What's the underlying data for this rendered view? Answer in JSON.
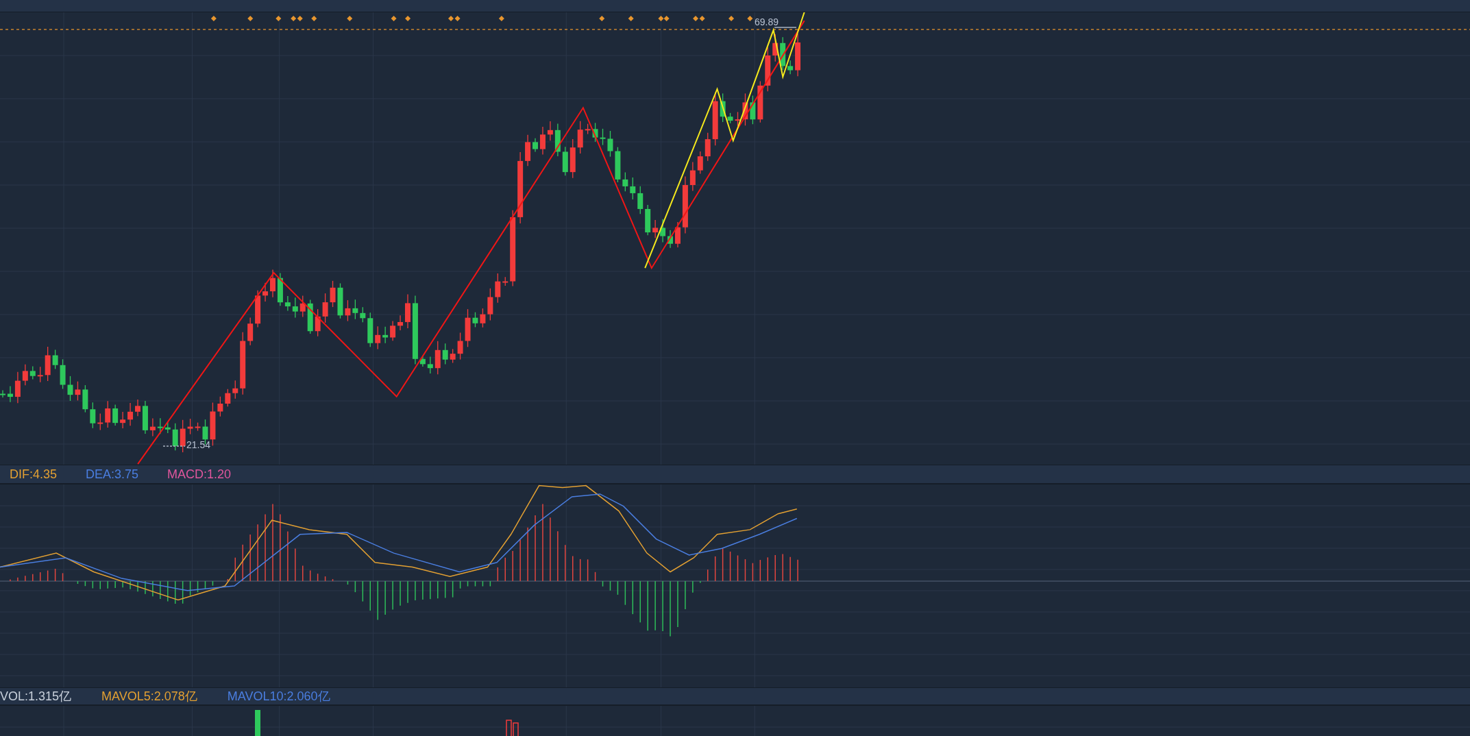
{
  "price_pane": {
    "high_label": "69.89",
    "low_label": "21.54"
  },
  "macd_legend": [
    {
      "text": "DIF:4.35",
      "color": "#e3a032"
    },
    {
      "text": "DEA:3.75",
      "color": "#4a7ee0"
    },
    {
      "text": "MACD:1.20",
      "color": "#e0569c"
    }
  ],
  "volume_legend": [
    {
      "text": "VOL:1.315亿",
      "color": "#c9d1dc"
    },
    {
      "text": "MAVOL5:2.078亿",
      "color": "#e3a032"
    },
    {
      "text": "MAVOL10:2.060亿",
      "color": "#4a7ee0"
    }
  ]
}
